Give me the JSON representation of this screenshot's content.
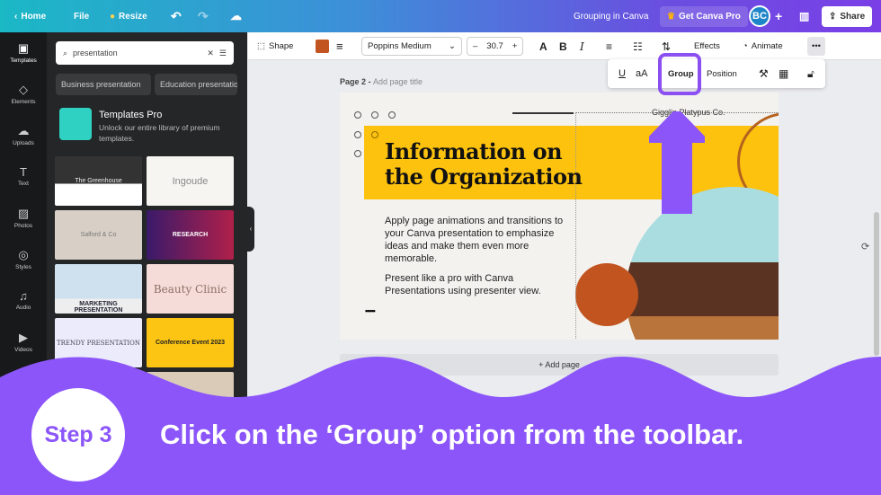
{
  "topbar": {
    "home": "Home",
    "file": "File",
    "resize": "Resize",
    "doc_title": "Grouping in Canva",
    "get_pro": "Get Canva Pro",
    "avatar": "BC",
    "share": "Share"
  },
  "rail": [
    {
      "label": "Templates",
      "icon": "▣"
    },
    {
      "label": "Elements",
      "icon": "◇"
    },
    {
      "label": "Uploads",
      "icon": "☁"
    },
    {
      "label": "Text",
      "icon": "T"
    },
    {
      "label": "Photos",
      "icon": "▨"
    },
    {
      "label": "Styles",
      "icon": "◎"
    },
    {
      "label": "Audio",
      "icon": "♫"
    },
    {
      "label": "Videos",
      "icon": "▶"
    }
  ],
  "panel": {
    "search_value": "presentation",
    "chips": [
      "Business presentation",
      "Education presentation"
    ],
    "pro_title": "Templates Pro",
    "pro_desc": "Unlock our entire library of premium templates.",
    "thumbs": [
      "The Greenhouse",
      "Ingoude",
      "Salford & Co",
      "RESEARCH",
      "MARKETING PRESENTATION",
      "Beauty Clinic",
      "TRENDY PRESENTATION",
      "Conference Event 2023"
    ]
  },
  "toolbar": {
    "shape": "Shape",
    "font": "Poppins Medium",
    "minus": "–",
    "size": "30.7",
    "plus": "+",
    "effects": "Effects",
    "animate": "Animate",
    "more": "•••",
    "color": "#c1541f"
  },
  "popup": {
    "underline": "U",
    "case": "aA",
    "group": "Group",
    "position": "Position"
  },
  "page": {
    "label": "Page 2 - ",
    "title_placeholder": "Add page title",
    "add_page": "+ Add page"
  },
  "slide": {
    "brand": "Gigglin Platypus Co.",
    "title_l1": "Information on",
    "title_l2": "the Organization",
    "body1": "Apply page animations and transitions to your Canva presentation to emphasize ideas and make them even more memorable.",
    "body2": "Present like a pro with Canva Presentations using presenter view.",
    "dots": "•••••"
  },
  "overlay": {
    "step": "Step 3",
    "caption": "Click on the ‘Group’ option from the toolbar.",
    "accent": "#8b55f9"
  }
}
